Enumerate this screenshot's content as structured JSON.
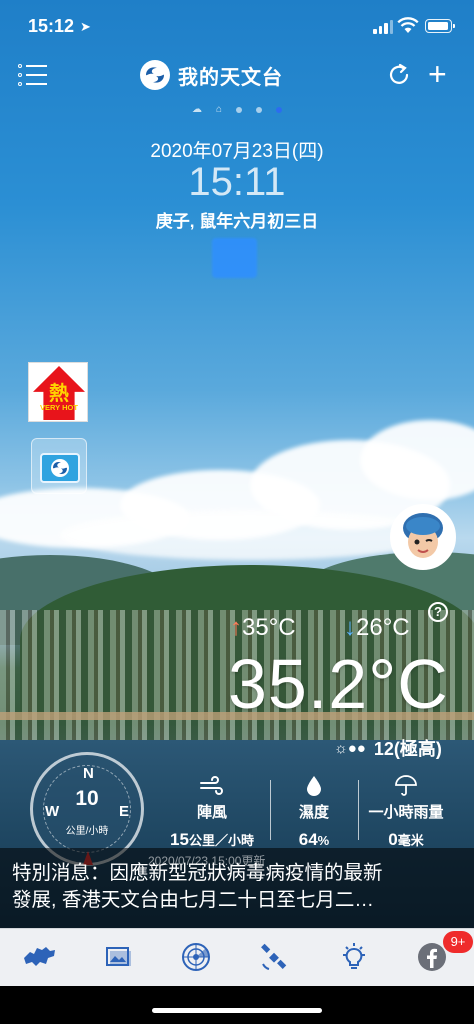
{
  "status_bar": {
    "time": "15:12"
  },
  "header": {
    "title": "我的天文台"
  },
  "datetime": {
    "date": "2020年07月23日(四)",
    "clock": "15:11",
    "lunar": "庚子, 鼠年六月初三日"
  },
  "warnings": {
    "hot": {
      "kanji": "熱",
      "text": "VERY HOT",
      "color": "#e8141b"
    }
  },
  "temperature": {
    "max": "35°C",
    "min": "26°C",
    "current": "35.2°C",
    "uv": "12(極高)"
  },
  "wind": {
    "north": "N",
    "west": "W",
    "east": "E",
    "speed": "10",
    "unit": "公里/小時"
  },
  "stats": {
    "gust_label": "陣風",
    "gust_value": "15",
    "gust_unit": "公里／小時",
    "humidity_label": "濕度",
    "humidity_value": "64",
    "humidity_unit": "%",
    "rain_label": "一小時雨量",
    "rain_value": "0",
    "rain_unit": "毫米"
  },
  "updated": "2020/07/23 15:00更新",
  "notice": {
    "line1": "特別消息：因應新型冠狀病毒病疫情的最新",
    "line2": "發展,  香港天文台由七月二十日至七月二…"
  },
  "tabbar": {
    "badge": "9+",
    "items": [
      "map-icon",
      "gallery-icon",
      "radar-icon",
      "satellite-icon",
      "tips-icon",
      "facebook-icon"
    ]
  },
  "colors": {
    "accent": "#2c6cf0",
    "tab_icon": "#2d63b8",
    "badge": "#ef2b2b"
  }
}
